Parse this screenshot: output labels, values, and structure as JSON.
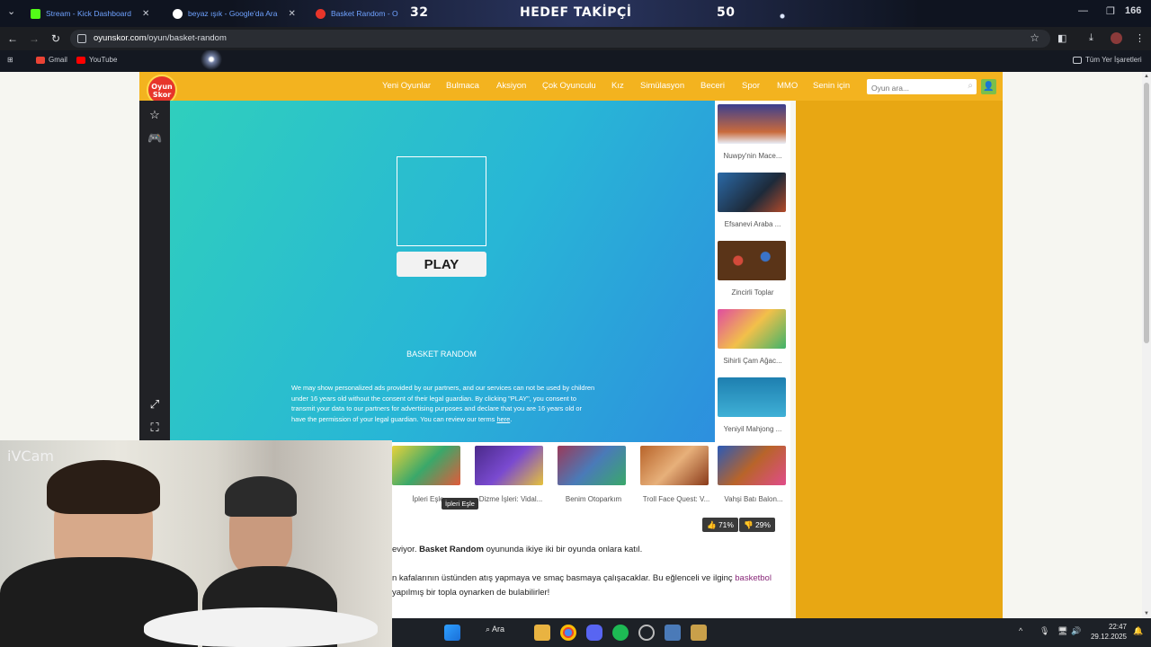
{
  "browser": {
    "tabs": [
      {
        "label": "Stream - Kick Dashboard",
        "color": "#53fc18"
      },
      {
        "label": "beyaz ışık - Google'da Ara",
        "color": "#ffffff"
      },
      {
        "label": "Basket Random - O",
        "color": "#e7352a"
      }
    ],
    "overlay": {
      "left_count": "32",
      "title": "HEDEF TAKİPÇİ",
      "right_count": "50"
    },
    "window_corner": "166",
    "url_host": "oyunskor.com",
    "url_path": "/oyun/basket-random",
    "bookmarks": [
      {
        "label": "Gmail",
        "color": "#ea4335"
      },
      {
        "label": "YouTube",
        "color": "#ff0000"
      }
    ],
    "all_bookmarks": "Tüm Yer İşaretleri"
  },
  "site": {
    "logo_top": "Oyun",
    "logo_bottom": "Skor",
    "menu": [
      "Yeni Oyunlar",
      "Bulmaca",
      "Aksiyon",
      "Çok Oyunculu",
      "Kız",
      "Simülasyon",
      "Beceri",
      "Spor",
      "MMO",
      "Senin için"
    ],
    "search_placeholder": "Oyun ara...",
    "accent": "#f3b31f"
  },
  "game": {
    "play_label": "PLAY",
    "title": "BASKET RANDOM",
    "consent": "We may show personalized ads provided by our partners, and our services can not be used by children under 16 years old without the consent of their legal guardian. By clicking \"PLAY\", you consent to transmit your data to our partners for advertising purposes and declare that you are 16 years old or have the permission of your legal guardian. You can review our terms",
    "consent_link": "here"
  },
  "rail_games": [
    "Nuwpy'nin Mace...",
    "Efsanevi Araba ...",
    "Zincirli Toplar",
    "Sihirli Çam Ağac...",
    "Yeniyil Mahjong ..."
  ],
  "bottom_games": [
    "İpleri Eşle",
    "Dizme İşleri: Vidal...",
    "Benim Otoparkım",
    "Troll Face Quest: V...",
    "Vahşi Batı Balon..."
  ],
  "tooltip": "İpleri Eşle",
  "votes": {
    "up": "71%",
    "down": "29%"
  },
  "description": {
    "line1_pre": "eviyor.",
    "line1_bold": "Basket Random",
    "line1_post": "oyununda ikiye iki bir oyunda onlara katıl.",
    "line2_pre": "n kafalarının üstünden atış yapmaya ve smaç basmaya çalışacaklar. Bu eğlenceli ve ilginç",
    "line2_link": "basketbol",
    "line3": "yapılmış bir topla oynarken de bulabilirler!"
  },
  "webcam": {
    "label": "iVCam"
  },
  "taskbar": {
    "search_label": "Ara",
    "time": "22:47",
    "date": "29.12.2025"
  }
}
